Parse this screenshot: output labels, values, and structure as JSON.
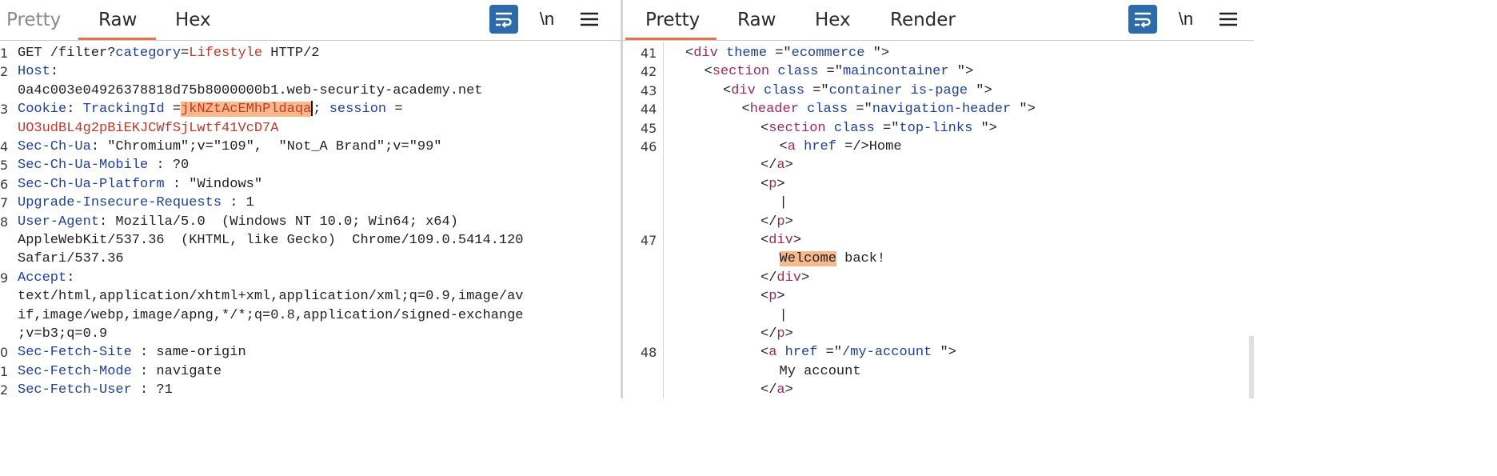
{
  "left": {
    "tabs": [
      "Pretty",
      "Raw",
      "Hex"
    ],
    "active_tab": "Raw",
    "toolbar": {
      "newline_label": "\\n"
    },
    "lines": [
      {
        "n": "1",
        "parts": [
          [
            "GET /filter?",
            ""
          ],
          [
            "category",
            "k"
          ],
          [
            "=",
            ""
          ],
          [
            "Lifestyle",
            "v"
          ],
          [
            " HTTP/2",
            ""
          ]
        ]
      },
      {
        "n": "2",
        "parts": [
          [
            "Host",
            "k"
          ],
          [
            ":",
            ""
          ]
        ]
      },
      {
        "n": "",
        "parts": [
          [
            "0a4c003e04926378818d75b8000000b1.web-security-academy.net",
            ""
          ]
        ]
      },
      {
        "n": "3",
        "parts": [
          [
            "Cookie",
            "k"
          ],
          [
            ": ",
            ""
          ],
          [
            "TrackingId",
            "k"
          ],
          [
            " =",
            ""
          ],
          [
            "jkNZtAcEMhPldaqa",
            "vh"
          ],
          [
            "|",
            ""
          ],
          [
            "; ",
            ""
          ],
          [
            "session",
            "k"
          ],
          [
            " =",
            ""
          ]
        ]
      },
      {
        "n": "",
        "parts": [
          [
            "UO3udBL4g2pBiEKJCWfSjLwtf41VcD7A",
            "v"
          ]
        ]
      },
      {
        "n": "4",
        "parts": [
          [
            "Sec-Ch-Ua",
            "k"
          ],
          [
            ": \"Chromium\";v=\"109\",  \"Not_A Brand\";v=\"99\"",
            ""
          ]
        ]
      },
      {
        "n": "5",
        "parts": [
          [
            "Sec-Ch-Ua-Mobile",
            "k"
          ],
          [
            " : ?0",
            ""
          ]
        ]
      },
      {
        "n": "6",
        "parts": [
          [
            "Sec-Ch-Ua-Platform",
            "k"
          ],
          [
            " : \"Windows\"",
            ""
          ]
        ]
      },
      {
        "n": "7",
        "parts": [
          [
            "Upgrade-Insecure-Requests",
            "k"
          ],
          [
            " : 1",
            ""
          ]
        ]
      },
      {
        "n": "8",
        "parts": [
          [
            "User-Agent",
            "k"
          ],
          [
            ": Mozilla/5.0  (Windows NT 10.0; Win64; x64)",
            ""
          ]
        ]
      },
      {
        "n": "",
        "parts": [
          [
            "AppleWebKit/537.36  (KHTML, like Gecko)  Chrome/109.0.5414.120",
            ""
          ]
        ]
      },
      {
        "n": "",
        "parts": [
          [
            "Safari/537.36",
            ""
          ]
        ]
      },
      {
        "n": "9",
        "parts": [
          [
            "Accept",
            "k"
          ],
          [
            ":",
            ""
          ]
        ]
      },
      {
        "n": "",
        "parts": [
          [
            "text/html,application/xhtml+xml,application/xml;q=0.9,image/av",
            ""
          ]
        ]
      },
      {
        "n": "",
        "parts": [
          [
            "if,image/webp,image/apng,*/*;q=0.8,application/signed-exchange",
            ""
          ]
        ]
      },
      {
        "n": "",
        "parts": [
          [
            ";v=b3;q=0.9",
            ""
          ]
        ]
      },
      {
        "n": "0",
        "parts": [
          [
            "Sec-Fetch-Site",
            "k"
          ],
          [
            " : same-origin",
            ""
          ]
        ]
      },
      {
        "n": "1",
        "parts": [
          [
            "Sec-Fetch-Mode",
            "k"
          ],
          [
            " : navigate",
            ""
          ]
        ]
      },
      {
        "n": "2",
        "parts": [
          [
            "Sec-Fetch-User",
            "k"
          ],
          [
            " : ?1",
            ""
          ]
        ]
      }
    ]
  },
  "right": {
    "tabs": [
      "Pretty",
      "Raw",
      "Hex",
      "Render"
    ],
    "active_tab": "Pretty",
    "toolbar": {
      "newline_label": "\\n"
    },
    "lines": [
      {
        "n": "41",
        "indent": 0,
        "parts": [
          [
            "<",
            ""
          ],
          [
            "div",
            "t"
          ],
          [
            " ",
            ""
          ],
          [
            "theme",
            "a"
          ],
          [
            " =\"",
            ""
          ],
          [
            "ecommerce",
            "s"
          ],
          [
            " \">",
            ""
          ]
        ]
      },
      {
        "n": "42",
        "indent": 1,
        "parts": [
          [
            "<",
            ""
          ],
          [
            "section",
            "t"
          ],
          [
            " ",
            ""
          ],
          [
            "class",
            "a"
          ],
          [
            " =\"",
            ""
          ],
          [
            "maincontainer",
            "s"
          ],
          [
            " \">",
            ""
          ]
        ]
      },
      {
        "n": "43",
        "indent": 2,
        "parts": [
          [
            "<",
            ""
          ],
          [
            "div",
            "t"
          ],
          [
            " ",
            ""
          ],
          [
            "class",
            "a"
          ],
          [
            " =\"",
            ""
          ],
          [
            "container is-page",
            "s"
          ],
          [
            " \">",
            ""
          ]
        ]
      },
      {
        "n": "44",
        "indent": 3,
        "parts": [
          [
            "<",
            ""
          ],
          [
            "header",
            "t"
          ],
          [
            " ",
            ""
          ],
          [
            "class",
            "a"
          ],
          [
            " =\"",
            ""
          ],
          [
            "navigation-header",
            "s"
          ],
          [
            " \">",
            ""
          ]
        ]
      },
      {
        "n": "45",
        "indent": 4,
        "parts": [
          [
            "<",
            ""
          ],
          [
            "section",
            "t"
          ],
          [
            " ",
            ""
          ],
          [
            "class",
            "a"
          ],
          [
            " =\"",
            ""
          ],
          [
            "top-links",
            "s"
          ],
          [
            " \">",
            ""
          ]
        ]
      },
      {
        "n": "46",
        "indent": 5,
        "parts": [
          [
            "<",
            ""
          ],
          [
            "a",
            "t"
          ],
          [
            " ",
            ""
          ],
          [
            "href",
            "a"
          ],
          [
            " =/>Home",
            ""
          ]
        ]
      },
      {
        "n": "",
        "indent": 4,
        "parts": [
          [
            "</",
            ""
          ],
          [
            "a",
            "t"
          ],
          [
            ">",
            ""
          ]
        ]
      },
      {
        "n": "",
        "indent": 4,
        "parts": [
          [
            "<",
            ""
          ],
          [
            "p",
            "t"
          ],
          [
            ">",
            ""
          ]
        ]
      },
      {
        "n": "",
        "indent": 5,
        "parts": [
          [
            "|",
            ""
          ]
        ]
      },
      {
        "n": "",
        "indent": 4,
        "parts": [
          [
            "</",
            ""
          ],
          [
            "p",
            "t"
          ],
          [
            ">",
            ""
          ]
        ]
      },
      {
        "n": "47",
        "indent": 4,
        "parts": [
          [
            "<",
            ""
          ],
          [
            "div",
            "t"
          ],
          [
            ">",
            ""
          ]
        ]
      },
      {
        "n": "",
        "indent": 5,
        "parts": [
          [
            "Welcome",
            "vh2"
          ],
          [
            " back!",
            ""
          ]
        ]
      },
      {
        "n": "",
        "indent": 4,
        "parts": [
          [
            "</",
            ""
          ],
          [
            "div",
            "t"
          ],
          [
            ">",
            ""
          ]
        ]
      },
      {
        "n": "",
        "indent": 4,
        "parts": [
          [
            "<",
            ""
          ],
          [
            "p",
            "t"
          ],
          [
            ">",
            ""
          ]
        ]
      },
      {
        "n": "",
        "indent": 5,
        "parts": [
          [
            "|",
            ""
          ]
        ]
      },
      {
        "n": "",
        "indent": 4,
        "parts": [
          [
            "</",
            ""
          ],
          [
            "p",
            "t"
          ],
          [
            ">",
            ""
          ]
        ]
      },
      {
        "n": "48",
        "indent": 4,
        "parts": [
          [
            "<",
            ""
          ],
          [
            "a",
            "t"
          ],
          [
            " ",
            ""
          ],
          [
            "href",
            "a"
          ],
          [
            " =\"",
            ""
          ],
          [
            "/my-account",
            "s"
          ],
          [
            " \">",
            ""
          ]
        ]
      },
      {
        "n": "",
        "indent": 5,
        "parts": [
          [
            "My account",
            ""
          ]
        ]
      },
      {
        "n": "",
        "indent": 4,
        "parts": [
          [
            "</",
            ""
          ],
          [
            "a",
            "t"
          ],
          [
            ">",
            ""
          ]
        ]
      }
    ]
  }
}
